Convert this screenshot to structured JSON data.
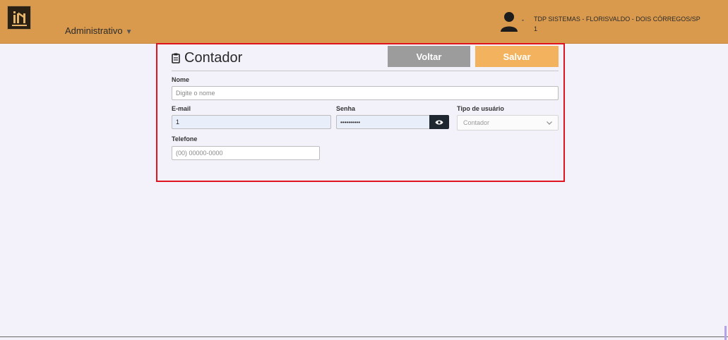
{
  "header": {
    "menu_label": "Administrativo",
    "company": "TDP SISTEMAS - FLORISVALDO - DOIS CÓRREGOS/SP",
    "user_id": "1",
    "brand_color": "#d99a4e"
  },
  "form": {
    "title": "Contador",
    "title_icon": "clipboard-icon",
    "buttons": {
      "back": "Voltar",
      "save": "Salvar"
    },
    "fields": {
      "name": {
        "label": "Nome",
        "placeholder": "Digite o nome",
        "value": ""
      },
      "email": {
        "label": "E-mail",
        "value": "1"
      },
      "password": {
        "label": "Senha",
        "value": "••••••••••"
      },
      "user_type": {
        "label": "Tipo de usuário",
        "value": "Contador"
      },
      "phone": {
        "label": "Telefone",
        "placeholder": "(00) 00000-0000",
        "value": ""
      }
    }
  }
}
